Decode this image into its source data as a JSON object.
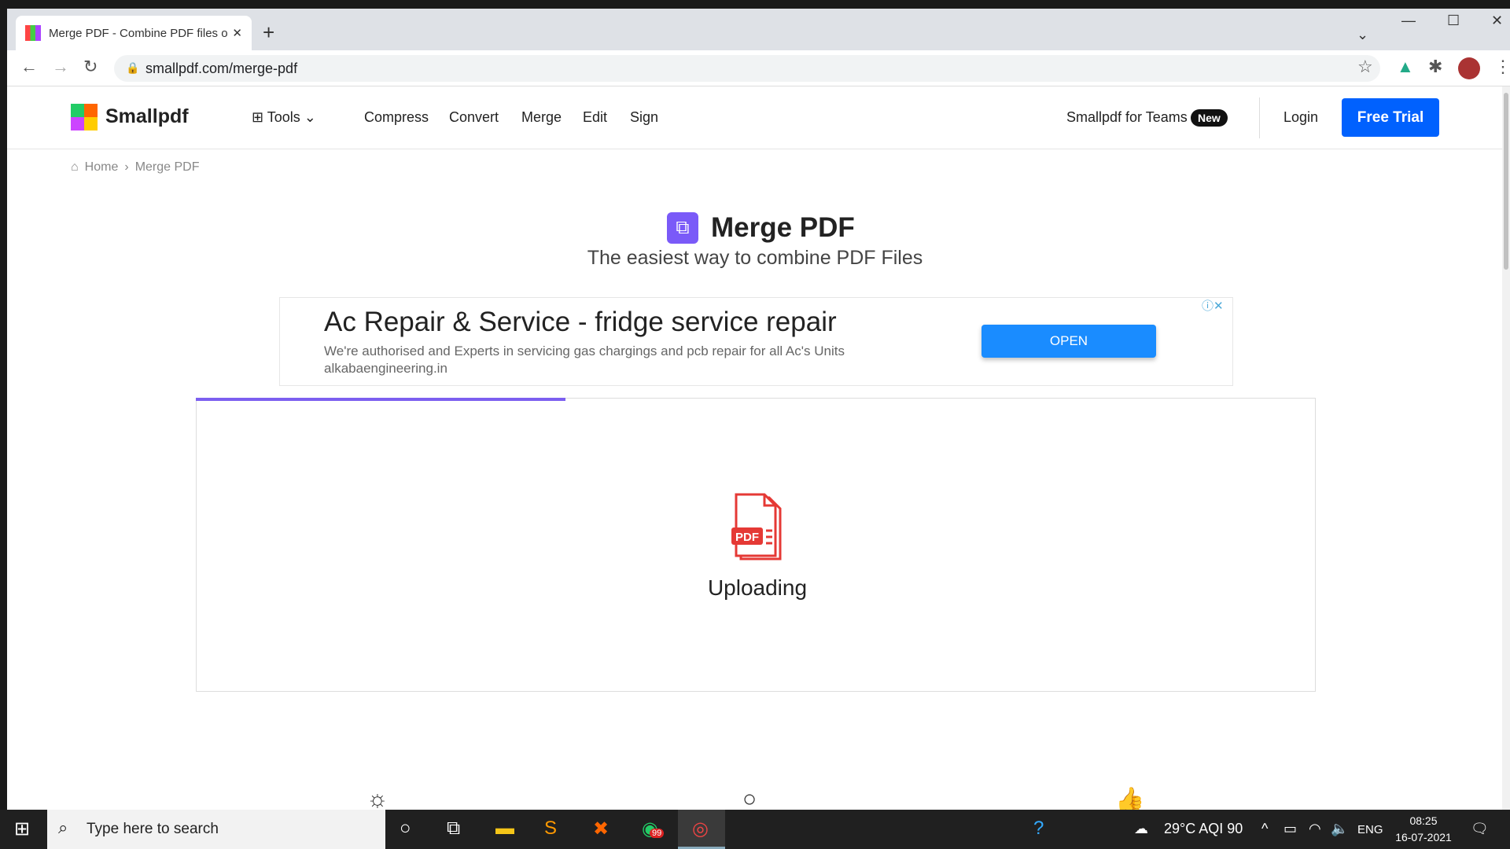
{
  "browser": {
    "tab_title": "Merge PDF - Combine PDF files o",
    "url": "smallpdf.com/merge-pdf"
  },
  "header": {
    "brand": "Smallpdf",
    "tools": "Tools",
    "nav": [
      "Compress",
      "Convert",
      "Merge",
      "Edit",
      "Sign"
    ],
    "teams": "Smallpdf for Teams",
    "badge": "New",
    "login": "Login",
    "trial": "Free Trial"
  },
  "breadcrumb": {
    "home": "Home",
    "sep": "›",
    "current": "Merge PDF"
  },
  "main": {
    "title": "Merge PDF",
    "subtitle": "The easiest way to combine PDF Files",
    "status": "Uploading",
    "progress_percent": 33,
    "pdf_label": "PDF"
  },
  "ad": {
    "headline": "Ac Repair & Service - fridge service repair",
    "body": "We're authorised and Experts in servicing gas chargings and pcb repair for all Ac's Units",
    "domain": "alkabaengineering.in",
    "cta": "OPEN"
  },
  "taskbar": {
    "search_placeholder": "Type here to search",
    "weather": "29°C  AQI 90",
    "lang": "ENG",
    "time": "08:25",
    "date": "16-07-2021",
    "whatsapp_badge": "99"
  }
}
